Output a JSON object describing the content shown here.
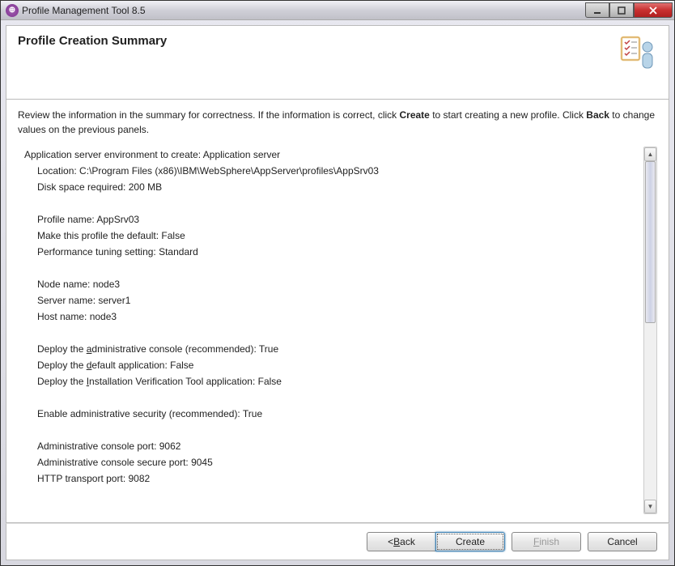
{
  "window": {
    "title": "Profile Management Tool 8.5"
  },
  "header": {
    "title": "Profile Creation Summary"
  },
  "intro": {
    "p1": "Review the information in the summary for correctness. If the information is correct, click ",
    "p1b": "Create",
    "p2": " to start creating a new profile. Click ",
    "p2b": "Back",
    "p3": " to change values on the previous panels."
  },
  "summary": {
    "env_label": "Application server environment to create: Application server",
    "location": "Location: C:\\Program Files (x86)\\IBM\\WebSphere\\AppServer\\profiles\\AppSrv03",
    "disk": "Disk space required: 200 MB",
    "profile_name": "Profile name: AppSrv03",
    "make_default": "Make this profile the default: False",
    "perf": "Performance tuning setting: Standard",
    "node": "Node name: node3",
    "server": "Server name: server1",
    "host": "Host name: node3",
    "deploy_console_pre": "Deploy the ",
    "deploy_console_acc": "a",
    "deploy_console_post": "dministrative console (recommended): True",
    "deploy_default_pre": "Deploy the ",
    "deploy_default_acc": "d",
    "deploy_default_post": "efault application: False",
    "deploy_ivt_pre": "Deploy the ",
    "deploy_ivt_acc": "I",
    "deploy_ivt_post": "nstallation Verification Tool application: False",
    "security": "Enable administrative security (recommended): True",
    "port_console": "Administrative console port: 9062",
    "port_console_secure": "Administrative console secure port: 9045",
    "port_http": "HTTP transport port: 9082"
  },
  "buttons": {
    "back_pre": "< ",
    "back_acc": "B",
    "back_post": "ack",
    "create": "Create",
    "finish_acc": "F",
    "finish_post": "inish",
    "cancel": "Cancel"
  }
}
